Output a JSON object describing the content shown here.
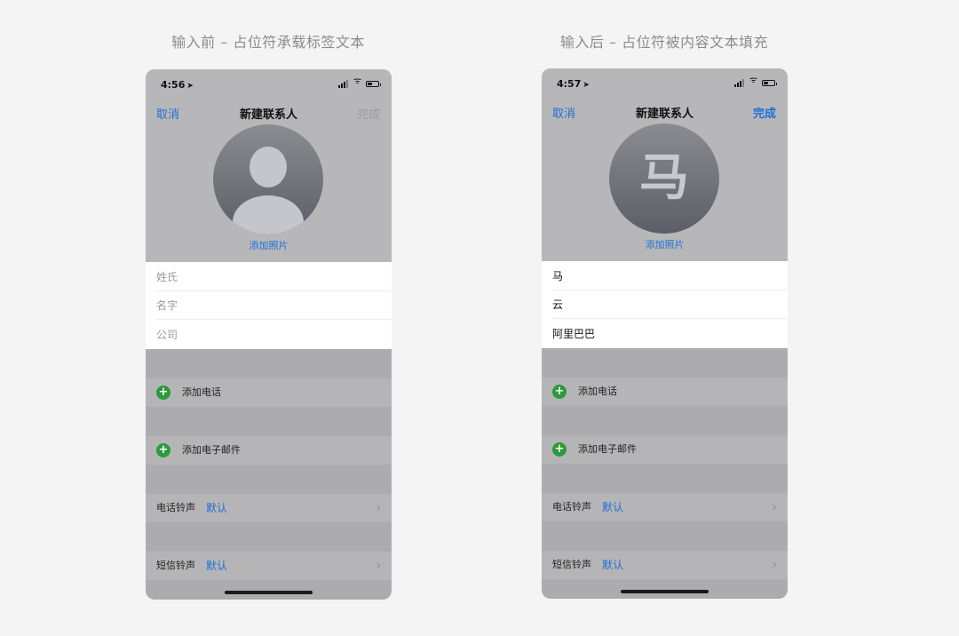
{
  "captions": {
    "before": "输入前 – 占位符承载标签文本",
    "after": "输入后 – 占位符被内容文本填充"
  },
  "before": {
    "time": "4:56",
    "nav": {
      "cancel": "取消",
      "title": "新建联系人",
      "done": "完成"
    },
    "add_photo": "添加照片",
    "fields": [
      {
        "placeholder": "姓氏",
        "value": ""
      },
      {
        "placeholder": "名字",
        "value": ""
      },
      {
        "placeholder": "公司",
        "value": ""
      }
    ],
    "rows": {
      "add_phone": "添加电话",
      "add_email": "添加电子邮件",
      "ringtone_label": "电话铃声",
      "ringtone_value": "默认",
      "texttone_label": "短信铃声",
      "texttone_value": "默认"
    }
  },
  "after": {
    "time": "4:57",
    "nav": {
      "cancel": "取消",
      "title": "新建联系人",
      "done": "完成"
    },
    "avatar_glyph": "马",
    "add_photo": "添加照片",
    "fields": [
      {
        "placeholder": "",
        "value": "马"
      },
      {
        "placeholder": "",
        "value": "云"
      },
      {
        "placeholder": "",
        "value": "阿里巴巴"
      }
    ],
    "rows": {
      "add_phone": "添加电话",
      "add_email": "添加电子邮件",
      "ringtone_label": "电话铃声",
      "ringtone_value": "默认",
      "texttone_label": "短信铃声",
      "texttone_value": "默认"
    }
  },
  "icons": {
    "location": "location-arrow-icon",
    "signal": "signal-icon",
    "wifi": "wifi-icon",
    "battery": "battery-icon",
    "add": "plus-circle-icon",
    "chevron": "chevron-right-icon"
  },
  "colors": {
    "accent": "#1f6fd6",
    "add_green": "#2a9a3a",
    "dim_background": "#acacae",
    "avatar_top": "#8a8c91",
    "avatar_bottom": "#5b5e66"
  }
}
